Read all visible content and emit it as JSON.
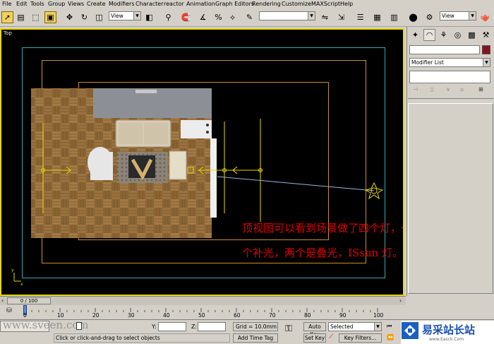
{
  "menu": [
    "File",
    "Edit",
    "Tools",
    "Group",
    "Views",
    "Create",
    "Modifiers",
    "Character",
    "reactor",
    "Animation",
    "Graph Editors",
    "Rendering",
    "Customize",
    "MAXScript",
    "Help"
  ],
  "toolbar": {
    "view_select": "View",
    "view_select_right": "View",
    "named_selection": ""
  },
  "viewport": {
    "label": "Top",
    "annotation_line1": "顶视图可以看到场景做了四个灯，一",
    "annotation_line2": "个补光，两个是叠光，ISsun 灯。"
  },
  "command_panel": {
    "modifier_list": "Modifier List"
  },
  "timeline": {
    "frame_counter": "0 / 100",
    "ticks": [
      "0",
      "10",
      "20",
      "30",
      "40",
      "50",
      "60",
      "70",
      "80",
      "90",
      "100"
    ]
  },
  "status": {
    "watermark_left": "www.sveen.com",
    "y_label": "Y:",
    "z_label": "Z:",
    "grid": "Grid = 10.0mm",
    "add_time_tag": "Add Time Tag",
    "auto_key": "Auto Key",
    "set_key": "Set Key",
    "selected": "Selected",
    "key_filters": "Key Filters...",
    "prompt": "Click or click-and-drag to select objects"
  },
  "logo": {
    "text": "易采站长站",
    "url": "www.Easck.Com"
  },
  "colors": {
    "viewport_border": "#e8d800",
    "annotation": "#e00000",
    "frame_cyan": "#3aa8a8",
    "frame_orange": "#c89020",
    "light_yellow": "#e8d800"
  }
}
